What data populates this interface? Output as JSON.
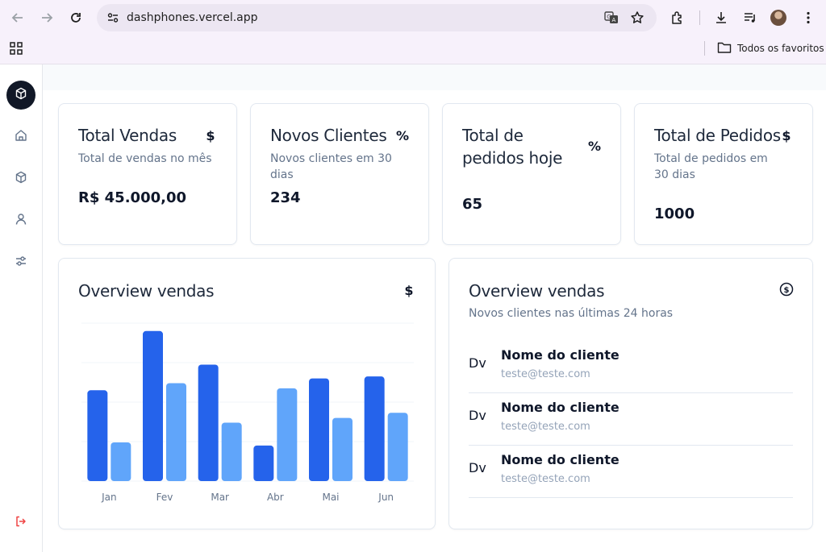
{
  "browser": {
    "url": "dashphones.vercel.app",
    "bookmarks_folder": "Todos os favoritos",
    "icons": [
      "back-icon",
      "forward-icon",
      "reload-icon",
      "site-info-icon",
      "translate-icon",
      "star-icon",
      "extensions-icon",
      "download-icon",
      "media-icon",
      "profile-avatar",
      "more-icon",
      "apps-icon",
      "folder-icon"
    ]
  },
  "sidebar": {
    "items": [
      {
        "name": "logo-box",
        "icon": "box-icon"
      },
      {
        "name": "home",
        "icon": "home-icon"
      },
      {
        "name": "products",
        "icon": "box-icon"
      },
      {
        "name": "users",
        "icon": "user-icon"
      },
      {
        "name": "settings",
        "icon": "sliders-icon"
      },
      {
        "name": "logout",
        "icon": "logout-icon"
      }
    ]
  },
  "stats": [
    {
      "title": "Total Vendas",
      "subtitle": "Total de vendas no mês",
      "value": "R$ 45.000,00",
      "icon": "$"
    },
    {
      "title": "Novos Clientes",
      "subtitle": "Novos clientes em 30 dias",
      "value": "234",
      "icon": "%"
    },
    {
      "title": "Total de pedidos hoje",
      "subtitle": "",
      "value": "65",
      "icon": "%"
    },
    {
      "title": "Total de Pedidos",
      "subtitle": "Total de pedidos em 30 dias",
      "value": "1000",
      "icon": "$"
    }
  ],
  "chart_card": {
    "title": "Overview vendas",
    "icon": "$"
  },
  "chart_data": {
    "type": "bar",
    "categories": [
      "Jan",
      "Fev",
      "Mar",
      "Abr",
      "Mai",
      "Jun"
    ],
    "series": [
      {
        "values": [
          230,
          380,
          295,
          90,
          260,
          265
        ]
      },
      {
        "values": [
          98,
          248,
          148,
          235,
          160,
          173
        ]
      }
    ],
    "ylim": [
      0,
      400
    ],
    "grid": true,
    "colors": [
      "#2563eb",
      "#60a5fa"
    ]
  },
  "customers_card": {
    "title": "Overview vendas",
    "subtitle": "Novos clientes nas últimas 24 horas",
    "icon": "dollar-circle-icon",
    "rows": [
      {
        "avatar": "Dv",
        "name": "Nome do cliente",
        "email": "teste@teste.com"
      },
      {
        "avatar": "Dv",
        "name": "Nome do cliente",
        "email": "teste@teste.com"
      },
      {
        "avatar": "Dv",
        "name": "Nome do cliente",
        "email": "teste@teste.com"
      }
    ]
  }
}
